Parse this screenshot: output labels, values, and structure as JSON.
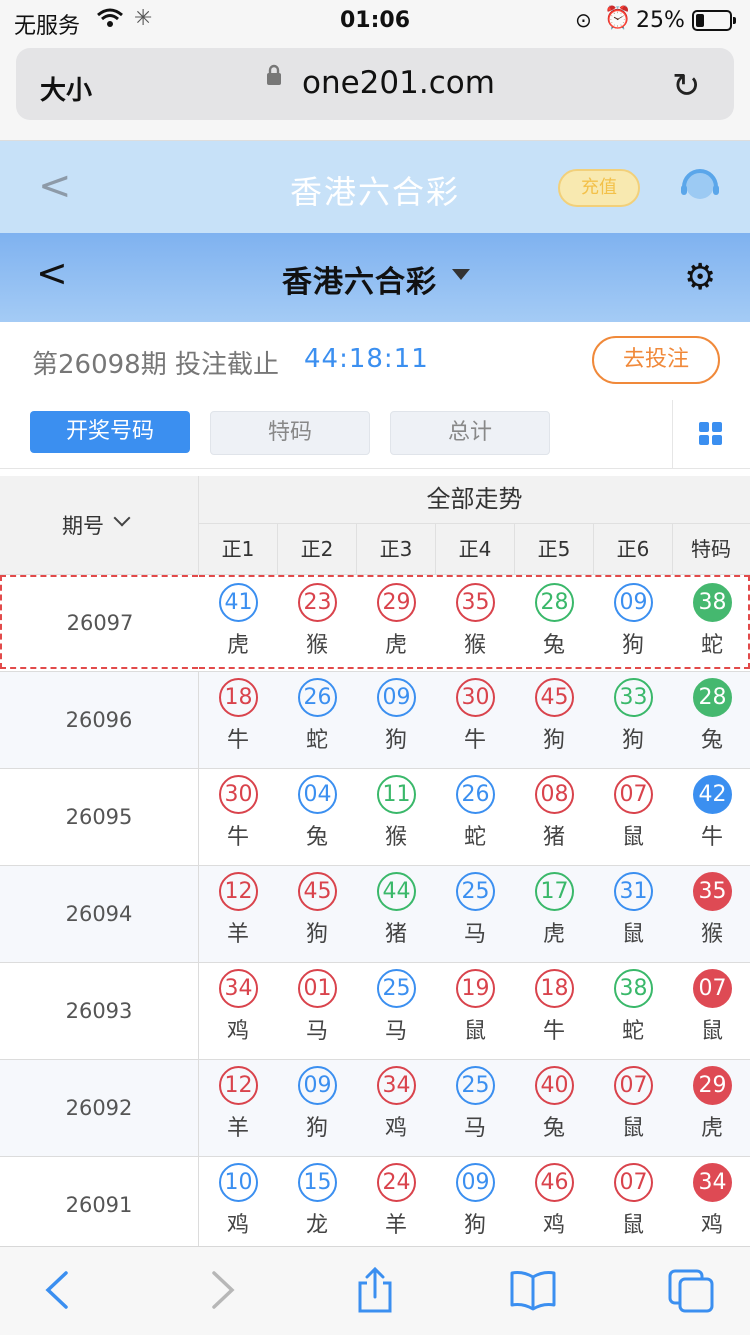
{
  "status": {
    "carrier": "无服务",
    "time": "01:06",
    "battery": "25%"
  },
  "browser": {
    "text_size": "大小",
    "url": "one201.com"
  },
  "app_header": {
    "title": "香港六合彩",
    "recharge": "充值"
  },
  "sub_header": {
    "title": "香港六合彩"
  },
  "period": {
    "label": "第26098期 投注截止",
    "countdown": "44:18:11",
    "bet_button": "去投注"
  },
  "tabs": [
    "开奖号码",
    "特码",
    "总计"
  ],
  "table": {
    "issue_header": "期号",
    "group_header": "全部走势",
    "columns": [
      "正1",
      "正2",
      "正3",
      "正4",
      "正5",
      "正6",
      "特码"
    ],
    "rows": [
      {
        "issue": "26097",
        "balls": [
          {
            "n": "41",
            "z": "虎",
            "c": "blue"
          },
          {
            "n": "23",
            "z": "猴",
            "c": "red"
          },
          {
            "n": "29",
            "z": "虎",
            "c": "red"
          },
          {
            "n": "35",
            "z": "猴",
            "c": "red"
          },
          {
            "n": "28",
            "z": "兔",
            "c": "green"
          },
          {
            "n": "09",
            "z": "狗",
            "c": "blue"
          },
          {
            "n": "38",
            "z": "蛇",
            "c": "green"
          }
        ]
      },
      {
        "issue": "26096",
        "balls": [
          {
            "n": "18",
            "z": "牛",
            "c": "red"
          },
          {
            "n": "26",
            "z": "蛇",
            "c": "blue"
          },
          {
            "n": "09",
            "z": "狗",
            "c": "blue"
          },
          {
            "n": "30",
            "z": "牛",
            "c": "red"
          },
          {
            "n": "45",
            "z": "狗",
            "c": "red"
          },
          {
            "n": "33",
            "z": "狗",
            "c": "green"
          },
          {
            "n": "28",
            "z": "兔",
            "c": "green"
          }
        ]
      },
      {
        "issue": "26095",
        "balls": [
          {
            "n": "30",
            "z": "牛",
            "c": "red"
          },
          {
            "n": "04",
            "z": "兔",
            "c": "blue"
          },
          {
            "n": "11",
            "z": "猴",
            "c": "green"
          },
          {
            "n": "26",
            "z": "蛇",
            "c": "blue"
          },
          {
            "n": "08",
            "z": "猪",
            "c": "red"
          },
          {
            "n": "07",
            "z": "鼠",
            "c": "red"
          },
          {
            "n": "42",
            "z": "牛",
            "c": "blue"
          }
        ]
      },
      {
        "issue": "26094",
        "balls": [
          {
            "n": "12",
            "z": "羊",
            "c": "red"
          },
          {
            "n": "45",
            "z": "狗",
            "c": "red"
          },
          {
            "n": "44",
            "z": "猪",
            "c": "green"
          },
          {
            "n": "25",
            "z": "马",
            "c": "blue"
          },
          {
            "n": "17",
            "z": "虎",
            "c": "green"
          },
          {
            "n": "31",
            "z": "鼠",
            "c": "blue"
          },
          {
            "n": "35",
            "z": "猴",
            "c": "red"
          }
        ]
      },
      {
        "issue": "26093",
        "balls": [
          {
            "n": "34",
            "z": "鸡",
            "c": "red"
          },
          {
            "n": "01",
            "z": "马",
            "c": "red"
          },
          {
            "n": "25",
            "z": "马",
            "c": "blue"
          },
          {
            "n": "19",
            "z": "鼠",
            "c": "red"
          },
          {
            "n": "18",
            "z": "牛",
            "c": "red"
          },
          {
            "n": "38",
            "z": "蛇",
            "c": "green"
          },
          {
            "n": "07",
            "z": "鼠",
            "c": "red"
          }
        ]
      },
      {
        "issue": "26092",
        "balls": [
          {
            "n": "12",
            "z": "羊",
            "c": "red"
          },
          {
            "n": "09",
            "z": "狗",
            "c": "blue"
          },
          {
            "n": "34",
            "z": "鸡",
            "c": "red"
          },
          {
            "n": "25",
            "z": "马",
            "c": "blue"
          },
          {
            "n": "40",
            "z": "兔",
            "c": "red"
          },
          {
            "n": "07",
            "z": "鼠",
            "c": "red"
          },
          {
            "n": "29",
            "z": "虎",
            "c": "red"
          }
        ]
      },
      {
        "issue": "26091",
        "balls": [
          {
            "n": "10",
            "z": "鸡",
            "c": "blue"
          },
          {
            "n": "15",
            "z": "龙",
            "c": "blue"
          },
          {
            "n": "24",
            "z": "羊",
            "c": "red"
          },
          {
            "n": "09",
            "z": "狗",
            "c": "blue"
          },
          {
            "n": "46",
            "z": "鸡",
            "c": "red"
          },
          {
            "n": "07",
            "z": "鼠",
            "c": "red"
          },
          {
            "n": "34",
            "z": "鸡",
            "c": "red"
          }
        ]
      }
    ]
  },
  "colors": {
    "accent": "#3b8ff0",
    "red": "#d9434c",
    "green": "#3ab86a",
    "orange": "#f0893a"
  }
}
